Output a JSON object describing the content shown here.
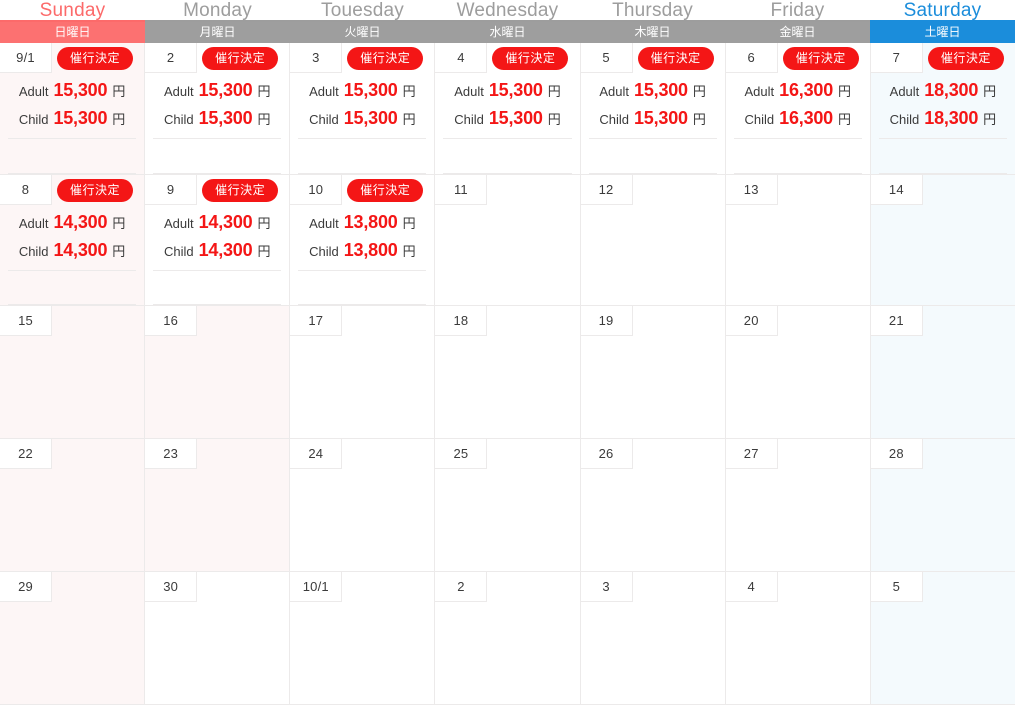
{
  "header": {
    "days_en": [
      "Sunday",
      "Monday",
      "Touesday",
      "Wednesday",
      "Thursday",
      "Friday",
      "Saturday"
    ],
    "days_jp": [
      "日曜日",
      "月曜日",
      "火曜日",
      "水曜日",
      "木曜日",
      "金曜日",
      "土曜日"
    ]
  },
  "labels": {
    "adult": "Adult",
    "child": "Child",
    "yen": "円",
    "badge": "催行決定"
  },
  "colors": {
    "sunday": "#fc7171",
    "weekday": "#9e9e9e",
    "saturday": "#1b8ddb",
    "price": "#f41616",
    "badge_bg": "#f41616",
    "sunday_cell": "#fdf6f6",
    "saturday_cell": "#f4fafd"
  },
  "weeks": [
    {
      "days": [
        {
          "date": "9/1",
          "tint": "sun",
          "badge": true,
          "adult": "15,300",
          "child": "15,300"
        },
        {
          "date": "2",
          "tint": "none",
          "badge": true,
          "adult": "15,300",
          "child": "15,300"
        },
        {
          "date": "3",
          "tint": "none",
          "badge": true,
          "adult": "15,300",
          "child": "15,300"
        },
        {
          "date": "4",
          "tint": "none",
          "badge": true,
          "adult": "15,300",
          "child": "15,300"
        },
        {
          "date": "5",
          "tint": "none",
          "badge": true,
          "adult": "15,300",
          "child": "15,300"
        },
        {
          "date": "6",
          "tint": "none",
          "badge": true,
          "adult": "16,300",
          "child": "16,300"
        },
        {
          "date": "7",
          "tint": "sat",
          "badge": true,
          "adult": "18,300",
          "child": "18,300"
        }
      ]
    },
    {
      "days": [
        {
          "date": "8",
          "tint": "sun",
          "badge": true,
          "adult": "14,300",
          "child": "14,300"
        },
        {
          "date": "9",
          "tint": "none",
          "badge": true,
          "adult": "14,300",
          "child": "14,300"
        },
        {
          "date": "10",
          "tint": "none",
          "badge": true,
          "adult": "13,800",
          "child": "13,800"
        },
        {
          "date": "11",
          "tint": "none",
          "badge": false,
          "adult": "",
          "child": ""
        },
        {
          "date": "12",
          "tint": "none",
          "badge": false,
          "adult": "",
          "child": ""
        },
        {
          "date": "13",
          "tint": "none",
          "badge": false,
          "adult": "",
          "child": ""
        },
        {
          "date": "14",
          "tint": "sat",
          "badge": false,
          "adult": "",
          "child": ""
        }
      ]
    },
    {
      "days": [
        {
          "date": "15",
          "tint": "sun",
          "badge": false,
          "adult": "",
          "child": ""
        },
        {
          "date": "16",
          "tint": "sun",
          "badge": false,
          "adult": "",
          "child": ""
        },
        {
          "date": "17",
          "tint": "none",
          "badge": false,
          "adult": "",
          "child": ""
        },
        {
          "date": "18",
          "tint": "none",
          "badge": false,
          "adult": "",
          "child": ""
        },
        {
          "date": "19",
          "tint": "none",
          "badge": false,
          "adult": "",
          "child": ""
        },
        {
          "date": "20",
          "tint": "none",
          "badge": false,
          "adult": "",
          "child": ""
        },
        {
          "date": "21",
          "tint": "sat",
          "badge": false,
          "adult": "",
          "child": ""
        }
      ]
    },
    {
      "days": [
        {
          "date": "22",
          "tint": "sun",
          "badge": false,
          "adult": "",
          "child": ""
        },
        {
          "date": "23",
          "tint": "sun",
          "badge": false,
          "adult": "",
          "child": ""
        },
        {
          "date": "24",
          "tint": "none",
          "badge": false,
          "adult": "",
          "child": ""
        },
        {
          "date": "25",
          "tint": "none",
          "badge": false,
          "adult": "",
          "child": ""
        },
        {
          "date": "26",
          "tint": "none",
          "badge": false,
          "adult": "",
          "child": ""
        },
        {
          "date": "27",
          "tint": "none",
          "badge": false,
          "adult": "",
          "child": ""
        },
        {
          "date": "28",
          "tint": "sat",
          "badge": false,
          "adult": "",
          "child": ""
        }
      ]
    },
    {
      "days": [
        {
          "date": "29",
          "tint": "sun",
          "badge": false,
          "adult": "",
          "child": ""
        },
        {
          "date": "30",
          "tint": "none",
          "badge": false,
          "adult": "",
          "child": ""
        },
        {
          "date": "10/1",
          "tint": "none",
          "badge": false,
          "adult": "",
          "child": ""
        },
        {
          "date": "2",
          "tint": "none",
          "badge": false,
          "adult": "",
          "child": ""
        },
        {
          "date": "3",
          "tint": "none",
          "badge": false,
          "adult": "",
          "child": ""
        },
        {
          "date": "4",
          "tint": "none",
          "badge": false,
          "adult": "",
          "child": ""
        },
        {
          "date": "5",
          "tint": "sat",
          "badge": false,
          "adult": "",
          "child": ""
        }
      ]
    }
  ]
}
